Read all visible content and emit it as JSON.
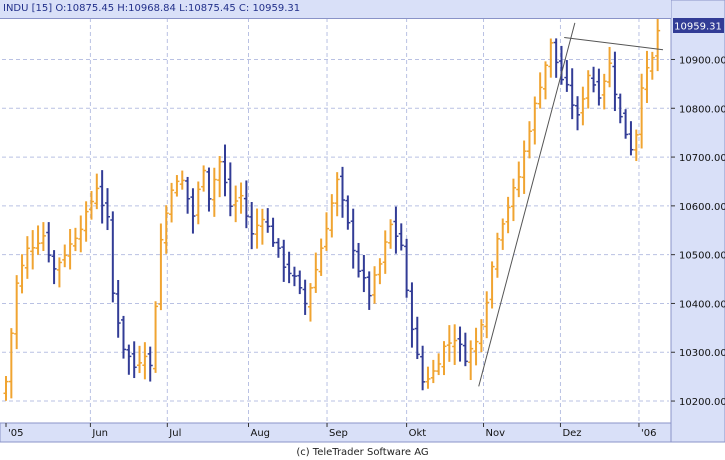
{
  "header": {
    "ohlc_text": "INDU [15] O:10875.45 H:10968.84 L:10875.45 C: 10959.31"
  },
  "last_price_label": "10959.31",
  "copyright": "(c) TeleTrader Software AG",
  "colors": {
    "up": "#f0a431",
    "down": "#323c96",
    "background": "#ffffff",
    "axis_panel": "#d9e0f8",
    "grid": "#b9c1e3",
    "trendline": "#555555"
  },
  "chart_data": {
    "type": "ohlc-bar",
    "symbol": "INDU",
    "y_ticks": [
      10200,
      10300,
      10400,
      10500,
      10600,
      10700,
      10800,
      10900
    ],
    "y_tick_labels": [
      "10200.00",
      "10300.00",
      "10400.00",
      "10500.00",
      "10600.00",
      "10700.00",
      "10800.00",
      "10900.00"
    ],
    "ylim": [
      10155,
      10985
    ],
    "x_labels": [
      "'05",
      "Jun",
      "Jul",
      "Aug",
      "Sep",
      "Okt",
      "Nov",
      "Dez",
      "'06"
    ],
    "x_label_positions": [
      0,
      15.8,
      30.2,
      45.4,
      60.1,
      75.0,
      89.4,
      103.8,
      118.5
    ],
    "xlim": [
      0,
      123
    ],
    "grid": true,
    "last_close": 10959.31,
    "anchors": [
      {
        "i": 0,
        "v": 10240
      },
      {
        "i": 2,
        "v": 10440
      },
      {
        "i": 4,
        "v": 10510
      },
      {
        "i": 7,
        "v": 10540
      },
      {
        "i": 9,
        "v": 10470
      },
      {
        "i": 12,
        "v": 10520
      },
      {
        "i": 15,
        "v": 10580
      },
      {
        "i": 17,
        "v": 10640
      },
      {
        "i": 19,
        "v": 10570
      },
      {
        "i": 20,
        "v": 10420
      },
      {
        "i": 22,
        "v": 10310
      },
      {
        "i": 24,
        "v": 10270
      },
      {
        "i": 26,
        "v": 10300
      },
      {
        "i": 27,
        "v": 10270
      },
      {
        "i": 29,
        "v": 10530
      },
      {
        "i": 31,
        "v": 10640
      },
      {
        "i": 33,
        "v": 10650
      },
      {
        "i": 35,
        "v": 10580
      },
      {
        "i": 37,
        "v": 10680
      },
      {
        "i": 38,
        "v": 10620
      },
      {
        "i": 40,
        "v": 10690
      },
      {
        "i": 42,
        "v": 10600
      },
      {
        "i": 44,
        "v": 10620
      },
      {
        "i": 46,
        "v": 10540
      },
      {
        "i": 48,
        "v": 10580
      },
      {
        "i": 50,
        "v": 10530
      },
      {
        "i": 52,
        "v": 10480
      },
      {
        "i": 54,
        "v": 10450
      },
      {
        "i": 56,
        "v": 10400
      },
      {
        "i": 58,
        "v": 10470
      },
      {
        "i": 60,
        "v": 10560
      },
      {
        "i": 62,
        "v": 10650
      },
      {
        "i": 64,
        "v": 10560
      },
      {
        "i": 66,
        "v": 10470
      },
      {
        "i": 68,
        "v": 10420
      },
      {
        "i": 70,
        "v": 10480
      },
      {
        "i": 72,
        "v": 10560
      },
      {
        "i": 74,
        "v": 10520
      },
      {
        "i": 75,
        "v": 10420
      },
      {
        "i": 77,
        "v": 10290
      },
      {
        "i": 78,
        "v": 10240
      },
      {
        "i": 80,
        "v": 10260
      },
      {
        "i": 82,
        "v": 10310
      },
      {
        "i": 84,
        "v": 10330
      },
      {
        "i": 86,
        "v": 10290
      },
      {
        "i": 88,
        "v": 10320
      },
      {
        "i": 90,
        "v": 10410
      },
      {
        "i": 92,
        "v": 10540
      },
      {
        "i": 94,
        "v": 10600
      },
      {
        "i": 96,
        "v": 10660
      },
      {
        "i": 98,
        "v": 10760
      },
      {
        "i": 100,
        "v": 10850
      },
      {
        "i": 102,
        "v": 10930
      },
      {
        "i": 104,
        "v": 10860
      },
      {
        "i": 105,
        "v": 10840
      },
      {
        "i": 107,
        "v": 10780
      },
      {
        "i": 109,
        "v": 10870
      },
      {
        "i": 111,
        "v": 10830
      },
      {
        "i": 113,
        "v": 10890
      },
      {
        "i": 115,
        "v": 10780
      },
      {
        "i": 117,
        "v": 10720
      },
      {
        "i": 118,
        "v": 10750
      },
      {
        "i": 119,
        "v": 10850
      },
      {
        "i": 121,
        "v": 10900
      },
      {
        "i": 122,
        "v": 10959
      }
    ],
    "trendlines": [
      {
        "x1": 88.5,
        "y1": 10230,
        "x2": 106.5,
        "y2": 10975
      },
      {
        "x1": 104.5,
        "y1": 10945,
        "x2": 123,
        "y2": 10920
      }
    ]
  }
}
